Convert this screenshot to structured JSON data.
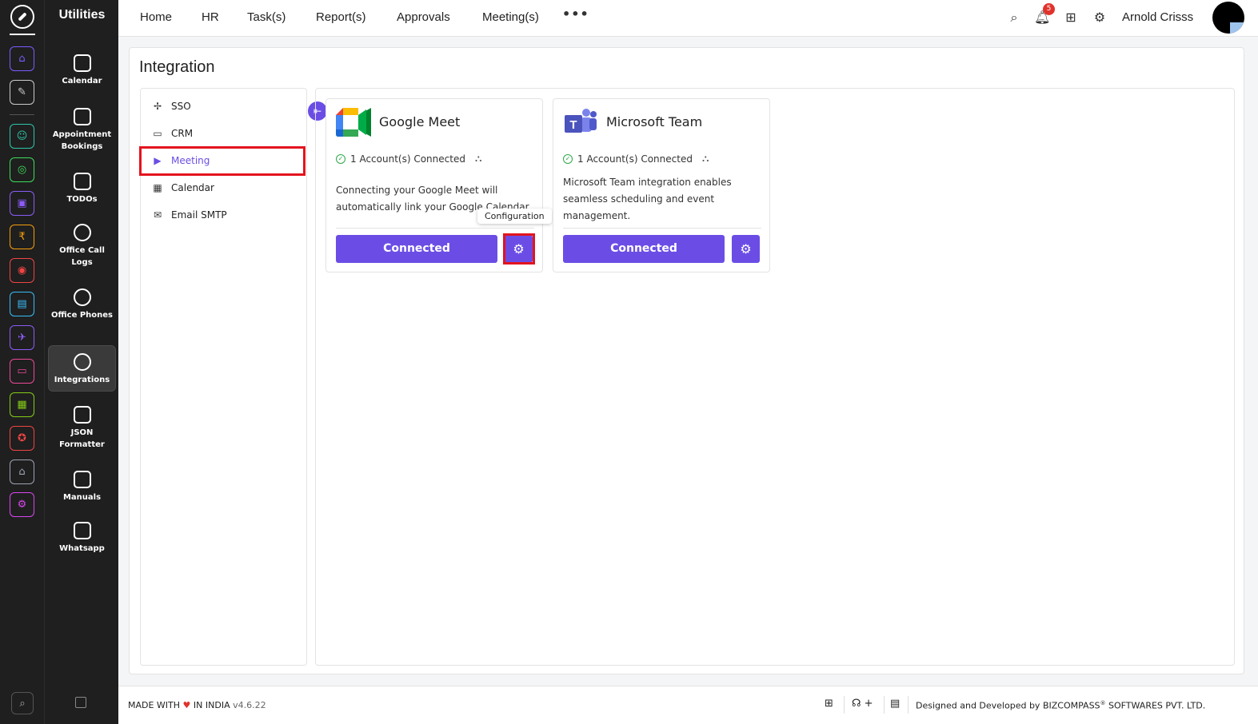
{
  "rail": {
    "icons": [
      {
        "name": "home-icon",
        "color": "#7c5cff",
        "glyph": "⌂"
      },
      {
        "name": "pin-icon",
        "color": "#cccccc",
        "glyph": "✎"
      },
      {
        "name": "people-icon",
        "color": "#2ec6a8",
        "glyph": "☺"
      },
      {
        "name": "target-icon",
        "color": "#3ddc5a",
        "glyph": "◎"
      },
      {
        "name": "briefcase-icon",
        "color": "#8b5cf6",
        "glyph": "▣"
      },
      {
        "name": "money-icon",
        "color": "#f59e0b",
        "glyph": "₹"
      },
      {
        "name": "dartboard-icon",
        "color": "#ef4444",
        "glyph": "◉"
      },
      {
        "name": "document-icon",
        "color": "#38bdf8",
        "glyph": "▤"
      },
      {
        "name": "airplane-icon",
        "color": "#8b5cf6",
        "glyph": "✈"
      },
      {
        "name": "monitor-icon",
        "color": "#ec4899",
        "glyph": "▭"
      },
      {
        "name": "report-icon",
        "color": "#84cc16",
        "glyph": "▦"
      },
      {
        "name": "award-icon",
        "color": "#ef4444",
        "glyph": "✪"
      },
      {
        "name": "house-icon",
        "color": "#9ca3af",
        "glyph": "⌂"
      },
      {
        "name": "settings-icon",
        "color": "#d946ef",
        "glyph": "⚙"
      }
    ],
    "search_glyph": "⌕"
  },
  "utilities": {
    "title": "Utilities",
    "items": [
      {
        "label": "Calendar"
      },
      {
        "label": "Appointment Bookings"
      },
      {
        "label": "TODOs"
      },
      {
        "label": "Office Call Logs"
      },
      {
        "label": "Office Phones"
      },
      {
        "label": "Integrations"
      },
      {
        "label": "JSON Formatter"
      },
      {
        "label": "Manuals"
      },
      {
        "label": "Whatsapp"
      }
    ]
  },
  "topbar": {
    "nav": [
      "Home",
      "HR",
      "Task(s)",
      "Report(s)",
      "Approvals",
      "Meeting(s)"
    ],
    "more": "•••",
    "notification_count": "5",
    "username": "Arnold Crisss"
  },
  "page": {
    "title": "Integration",
    "sidebar": [
      {
        "label": "SSO",
        "icon": "✢"
      },
      {
        "label": "CRM",
        "icon": "▭"
      },
      {
        "label": "Meeting",
        "icon": "▶"
      },
      {
        "label": "Calendar",
        "icon": "▦"
      },
      {
        "label": "Email SMTP",
        "icon": "✉"
      }
    ],
    "active_sidebar": "Meeting",
    "collapse_glyph": "⇤"
  },
  "cards": [
    {
      "title": "Google Meet",
      "status": "1 Account(s) Connected",
      "description": "Connecting your Google Meet will automatically link your Google Calendar",
      "button": "Connected",
      "tooltip": "Configuration"
    },
    {
      "title": "Microsoft Team",
      "status": "1 Account(s) Connected",
      "description": "Microsoft Team integration enables seamless scheduling and event management.",
      "button": "Connected"
    }
  ],
  "footer": {
    "made_prefix": "MADE WITH",
    "made_suffix": "IN INDIA",
    "version": "v4.6.22",
    "designed_prefix": "Designed and Developed by",
    "company": "BIZCOMPASS",
    "reg": "®",
    "company_suffix": "SOFTWARES PVT. LTD."
  },
  "colors": {
    "accent": "#6b4de6",
    "highlight": "#e3141e",
    "success": "#2ea84a"
  }
}
